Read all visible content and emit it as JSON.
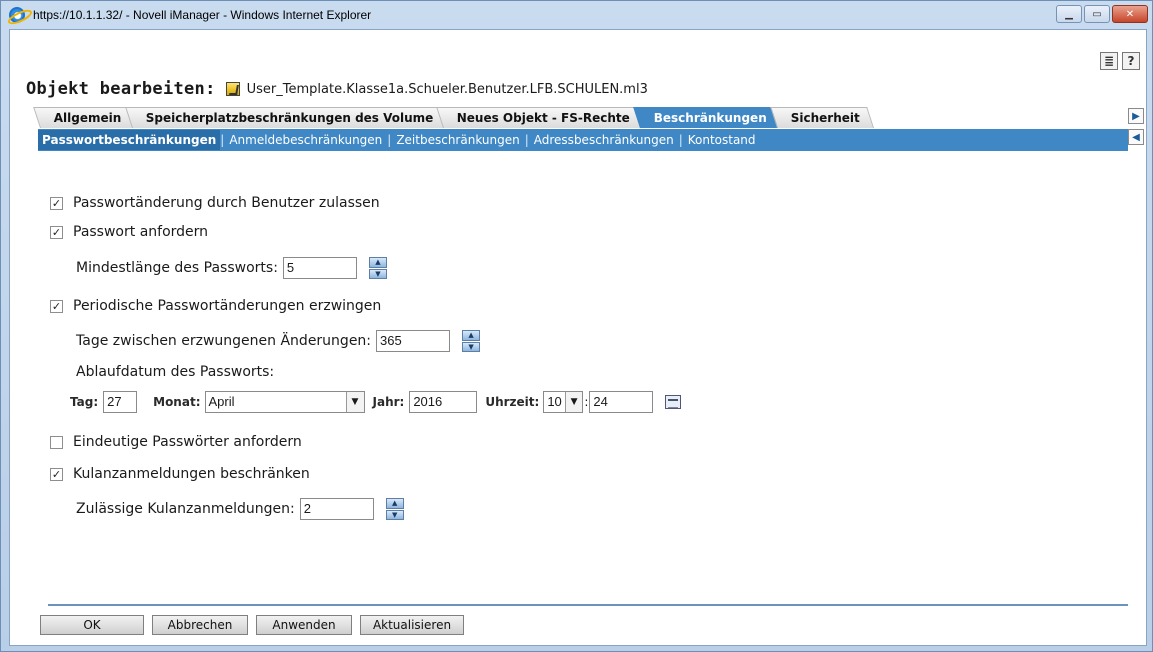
{
  "window": {
    "title": "https://10.1.1.32/ - Novell iManager - Windows Internet Explorer"
  },
  "header": {
    "label": "Objekt bearbeiten:",
    "object": "User_Template.Klasse1a.Schueler.Benutzer.LFB.SCHULEN.ml3"
  },
  "tabs": [
    {
      "label": "Allgemein",
      "active": false
    },
    {
      "label": "Speicherplatzbeschränkungen des Volume",
      "active": false
    },
    {
      "label": "Neues Objekt - FS-Rechte",
      "active": false
    },
    {
      "label": "Beschränkungen",
      "active": true
    },
    {
      "label": "Sicherheit",
      "active": false
    }
  ],
  "subtabs": [
    {
      "label": "Passwortbeschränkungen",
      "active": true
    },
    {
      "label": "Anmeldebeschränkungen",
      "active": false
    },
    {
      "label": "Zeitbeschränkungen",
      "active": false
    },
    {
      "label": "Adressbeschränkungen",
      "active": false
    },
    {
      "label": "Kontostand",
      "active": false
    }
  ],
  "form": {
    "allow_change": {
      "label": "Passwortänderung durch Benutzer zulassen",
      "checked": true
    },
    "require_password": {
      "label": "Passwort anfordern",
      "checked": true
    },
    "min_length": {
      "label": "Mindestlänge des Passworts:",
      "value": "5"
    },
    "periodic_change": {
      "label": "Periodische Passwortänderungen erzwingen",
      "checked": true
    },
    "days_between": {
      "label": "Tage zwischen erzwungenen Änderungen:",
      "value": "365"
    },
    "expiry": {
      "label": "Ablaufdatum des Passworts:",
      "day_label": "Tag:",
      "day": "27",
      "month_label": "Monat:",
      "month": "April",
      "year_label": "Jahr:",
      "year": "2016",
      "time_label": "Uhrzeit:",
      "hour": "10",
      "colon": ":",
      "minute": "24"
    },
    "unique": {
      "label": "Eindeutige Passwörter anfordern",
      "checked": false
    },
    "grace": {
      "label": "Kulanzanmeldungen beschränken",
      "checked": true
    },
    "grace_count": {
      "label": "Zulässige Kulanzanmeldungen:",
      "value": "2"
    }
  },
  "buttons": {
    "ok": "OK",
    "cancel": "Abbrechen",
    "apply": "Anwenden",
    "refresh": "Aktualisieren"
  },
  "icons": {
    "help": "?",
    "check": "✓"
  },
  "colors": {
    "accent": "#3f88c5"
  }
}
